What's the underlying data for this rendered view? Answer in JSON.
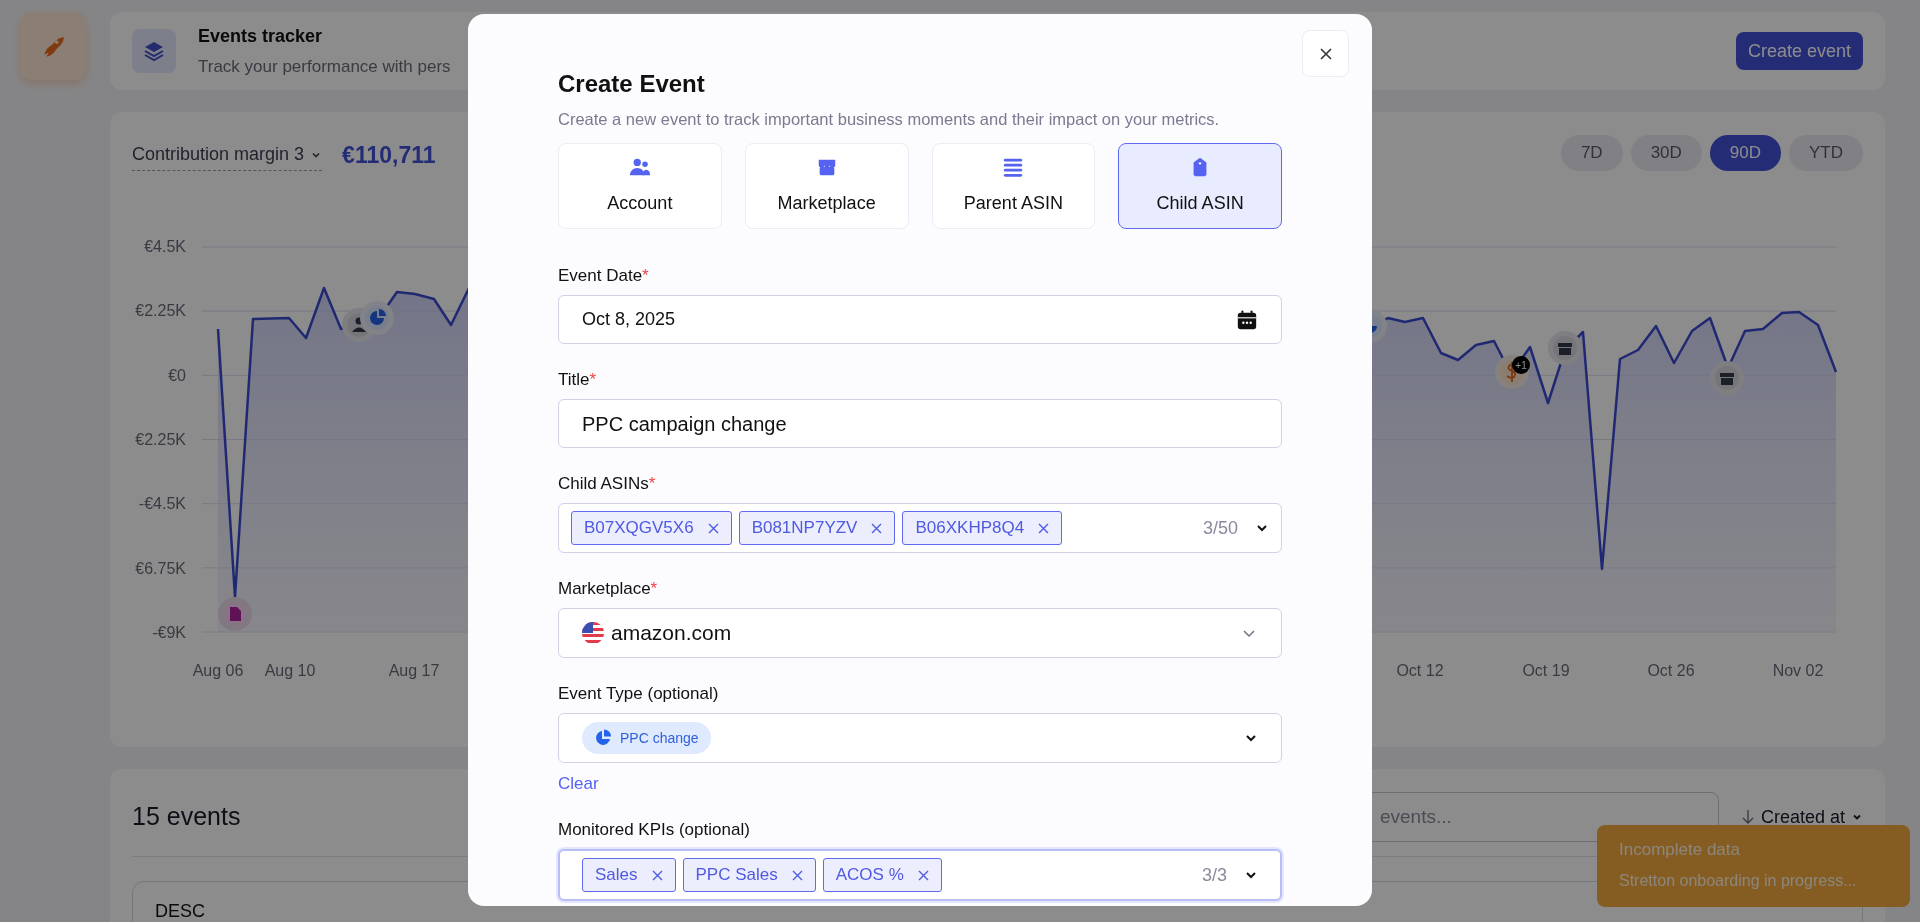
{
  "header": {
    "title": "Events tracker",
    "subtitle": "Track your performance with pers",
    "button": "Create event"
  },
  "chart_panel": {
    "metric": "Contribution margin 3",
    "total": "€110,711",
    "periods": [
      {
        "label": "7D",
        "selected": false
      },
      {
        "label": "30D",
        "selected": false
      },
      {
        "label": "90D",
        "selected": true
      },
      {
        "label": "YTD",
        "selected": false
      }
    ],
    "y_labels": [
      "€4.5K",
      "€2.25K",
      "€0",
      "€2.25K",
      "-€4.5K",
      "€6.75K",
      "-€9K"
    ],
    "x_labels": [
      "Aug 06",
      "Aug 10",
      "Aug 17",
      "Oct 12",
      "Oct 19",
      "Oct 26",
      "Nov 02"
    ],
    "marker_badge": "+1"
  },
  "events_panel": {
    "count": "15 events",
    "search_placeholder": "events...",
    "sort": "Created at",
    "card_title": "DESC"
  },
  "toast": {
    "title": "Incomplete data",
    "message": "Stretton onboarding in progress..."
  },
  "modal": {
    "title": "Create Event",
    "subtitle": "Create a new event to track important business moments and their impact on your metrics.",
    "scopes": [
      {
        "label": "Account",
        "kind": "users",
        "selected": false
      },
      {
        "label": "Marketplace",
        "kind": "store",
        "selected": false
      },
      {
        "label": "Parent ASIN",
        "kind": "list",
        "selected": false
      },
      {
        "label": "Child ASIN",
        "kind": "tag",
        "selected": true
      }
    ],
    "fields": [
      {
        "kind": "date",
        "label": "Event Date",
        "required_mark": "*",
        "value": "Oct 8, 2025"
      },
      {
        "kind": "text",
        "label": "Title",
        "required_mark": "*",
        "value": "PPC campaign change"
      },
      {
        "kind": "tags",
        "label": "Child ASINs",
        "required_mark": "*",
        "tags": [
          "B07XQGV5X6",
          "B081NP7YZV",
          "B06XKHP8Q4"
        ],
        "count": "3/50",
        "focused": false
      },
      {
        "kind": "select",
        "label": "Marketplace",
        "required_mark": "*",
        "value": "amazon.com"
      },
      {
        "kind": "chip",
        "label": "Event Type (optional)",
        "chip": "PPC change",
        "link": "Clear"
      },
      {
        "kind": "tags",
        "label": "Monitored KPIs (optional)",
        "tags": [
          "Sales",
          "PPC Sales",
          "ACOS %"
        ],
        "count": "3/3",
        "focused": true
      }
    ]
  }
}
